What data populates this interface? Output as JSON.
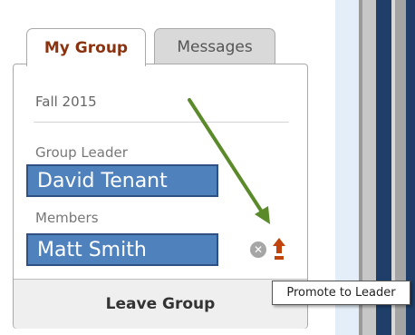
{
  "tabs": [
    {
      "label": "My Group",
      "active": true
    },
    {
      "label": "Messages",
      "active": false
    }
  ],
  "group": {
    "season": "Fall 2015",
    "leader_label": "Group Leader",
    "leader_name": "David Tenant",
    "members_label": "Members",
    "members": [
      {
        "name": "Matt Smith"
      }
    ]
  },
  "actions": {
    "remove_icon": "x-circle-icon",
    "promote_icon": "up-arrow-icon",
    "leave_label": "Leave Group"
  },
  "tooltip": {
    "text": "Promote to Leader"
  },
  "colors": {
    "active_tab_text": "#8a3310",
    "name_box_fill": "#4f81bd",
    "name_box_border": "#2f5082",
    "promote_icon": "#c0440c",
    "annotation_arrow": "#5b8a2b"
  }
}
